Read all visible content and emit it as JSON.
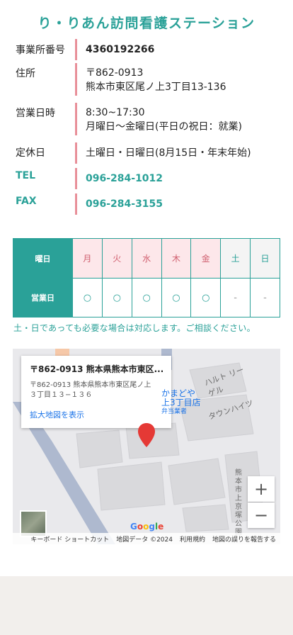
{
  "title": "り・りあん訪問看護ステーション",
  "info": {
    "office_no_label": "事業所番号",
    "office_no": "4360192266",
    "address_label": "住所",
    "postal": "〒862-0913",
    "address": "熊本市東区尾ノ上3丁目13-136",
    "hours_label": "営業日時",
    "hours": "8:30~17:30",
    "days": "月曜日〜金曜日(平日の祝日：就業)",
    "holiday_label": "定休日",
    "holiday": "土曜日・日曜日(8月15日・年末年始)",
    "tel_label": "TEL",
    "tel": "096-284-1012",
    "fax_label": "FAX",
    "fax": "096-284-3155"
  },
  "schedule": {
    "header_label": "曜日",
    "row_label": "営業日",
    "days": [
      "月",
      "火",
      "水",
      "木",
      "金",
      "土",
      "日"
    ],
    "marks": [
      "○",
      "○",
      "○",
      "○",
      "○",
      "-",
      "-"
    ]
  },
  "note": "土・日であっても必要な場合は対応します。ご相談ください。",
  "map": {
    "card_title": "〒862-0913 熊本県熊本市東区...",
    "card_address_1": "〒862-0913 熊本県熊本市東区尾ノ上",
    "card_address_2": "３丁目１３−１３６",
    "card_link": "拡大地図を表示",
    "poi_1a": "かまどや",
    "poi_1b": "上3丁目店",
    "poi_1c": "弁当業者",
    "poi_2": "ハルト リーゲル",
    "poi_3": "タウンハイツ",
    "poi_4": "熊本市上京塚公園",
    "zoom_in": "+",
    "zoom_out": "−",
    "google": "Google",
    "footer": [
      "キーボード ショートカット",
      "地図データ ©2024",
      "利用規約",
      "地図の誤りを報告する"
    ],
    "colors": {
      "accent": "#2aa198",
      "bar": "#e8909a",
      "pin": "#e53935",
      "link": "#1a73e8"
    }
  }
}
